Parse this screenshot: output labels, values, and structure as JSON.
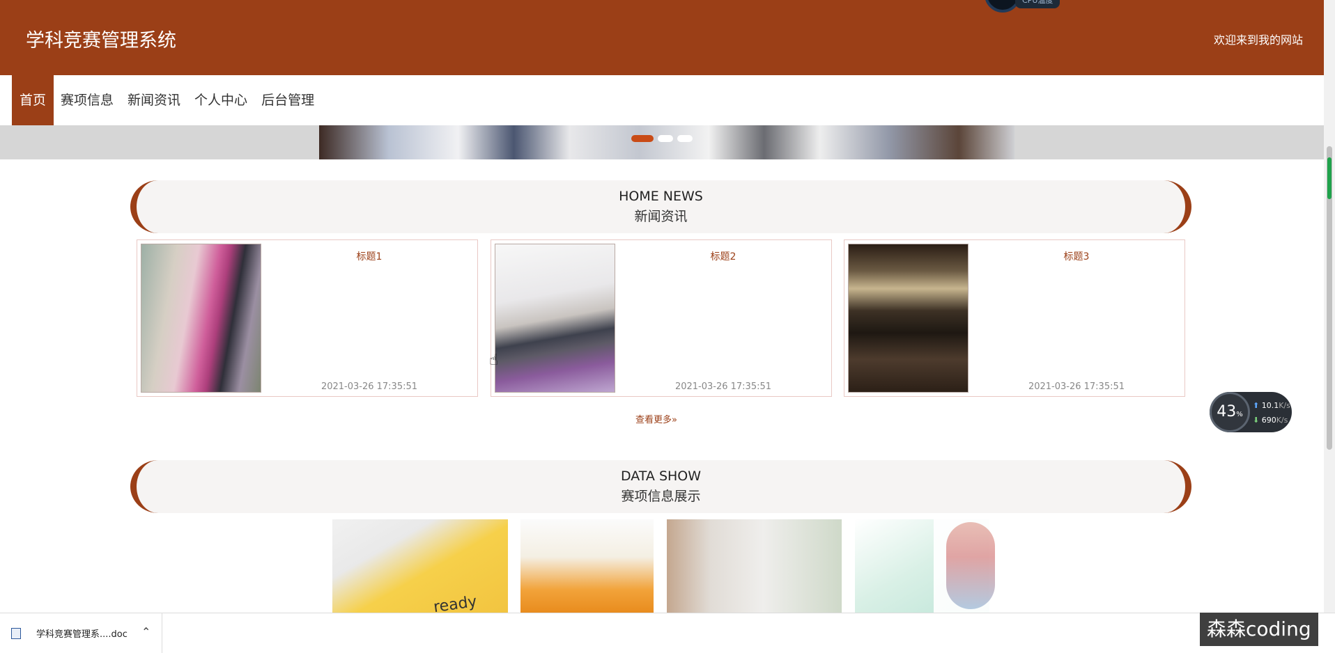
{
  "header": {
    "site_title": "学科竞赛管理系统",
    "welcome": "欢迎来到我的网站",
    "cpu_label": "CPU温度"
  },
  "nav": {
    "items": [
      {
        "label": "首页",
        "active": true
      },
      {
        "label": "赛项信息",
        "active": false
      },
      {
        "label": "新闻资讯",
        "active": false
      },
      {
        "label": "个人中心",
        "active": false
      },
      {
        "label": "后台管理",
        "active": false
      }
    ]
  },
  "banner": {
    "slides": 3,
    "active_slide": 1
  },
  "news_section": {
    "title_en": "HOME NEWS",
    "title_cn": "新闻资讯",
    "items": [
      {
        "title": "标题1",
        "time": "2021-03-26 17:35:51"
      },
      {
        "title": "标题2",
        "time": "2021-03-26 17:35:51"
      },
      {
        "title": "标题3",
        "time": "2021-03-26 17:35:51"
      }
    ],
    "more_label": "查看更多"
  },
  "data_section": {
    "title_en": "DATA SHOW",
    "title_cn": "赛项信息展示",
    "card1_text": "ready"
  },
  "net_widget": {
    "percent": "43",
    "percent_unit": "%",
    "upload": "10.1",
    "upload_unit": "K/s",
    "download": "690",
    "download_unit": "K/s"
  },
  "download_bar": {
    "file_name": "学科竞赛管理系....doc"
  },
  "watermark": "森森coding",
  "colors": {
    "brand": "#9b3f17",
    "accent_dot": "#c94b16"
  }
}
